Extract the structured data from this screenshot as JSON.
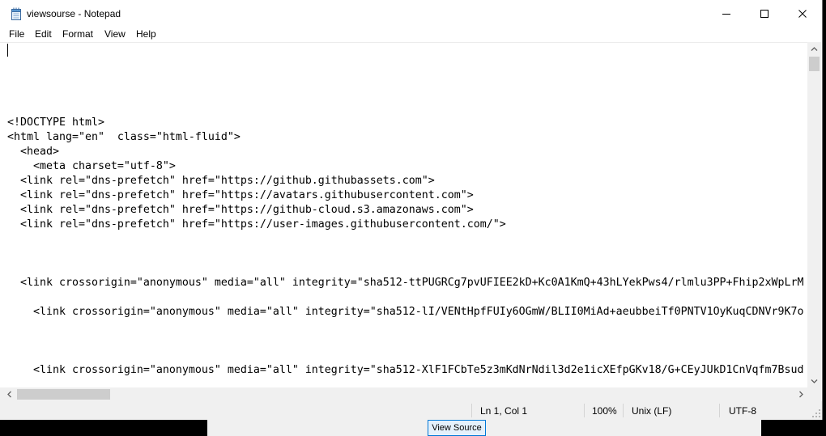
{
  "window": {
    "title": "viewsourse - Notepad",
    "app_icon": "notepad-icon",
    "controls": {
      "minimize": "minimize-icon",
      "maximize": "maximize-icon",
      "close": "close-icon"
    }
  },
  "menu": [
    {
      "label": "File"
    },
    {
      "label": "Edit"
    },
    {
      "label": "Format"
    },
    {
      "label": "View"
    },
    {
      "label": "Help"
    }
  ],
  "editor": {
    "lines": [
      "",
      "",
      "",
      "",
      "",
      "<!DOCTYPE html>",
      "<html lang=\"en\"  class=\"html-fluid\">",
      "  <head>",
      "    <meta charset=\"utf-8\">",
      "  <link rel=\"dns-prefetch\" href=\"https://github.githubassets.com\">",
      "  <link rel=\"dns-prefetch\" href=\"https://avatars.githubusercontent.com\">",
      "  <link rel=\"dns-prefetch\" href=\"https://github-cloud.s3.amazonaws.com\">",
      "  <link rel=\"dns-prefetch\" href=\"https://user-images.githubusercontent.com/\">",
      "",
      "",
      "",
      "  <link crossorigin=\"anonymous\" media=\"all\" integrity=\"sha512-ttPUGRCg7pvUFIEE2kD+Kc0A1KmQ+43hLYekPws4/rlmlu3PP+Fhip2xWpLrM",
      "",
      "    <link crossorigin=\"anonymous\" media=\"all\" integrity=\"sha512-lI/VENtHpfFUIy6OGmW/BLII0MiAd+aeubbeiTf0PNTV1OyKuqCDNVr9K7o",
      "",
      "",
      "",
      "    <link crossorigin=\"anonymous\" media=\"all\" integrity=\"sha512-XlF1FCbTe5z3mKdNrNdil3d2e1icXEfpGKv18/G+CEyJUkD1CnVqfm7Bsud"
    ]
  },
  "scrollbars": {
    "vertical": {
      "position_percent": 0,
      "up_icon": "chevron-up-icon",
      "down_icon": "chevron-down-icon"
    },
    "horizontal": {
      "position_percent": 0,
      "left_icon": "chevron-left-icon",
      "right_icon": "chevron-right-icon"
    }
  },
  "status": {
    "cursor": "Ln 1, Col 1",
    "zoom": "100%",
    "line_ending": "Unix (LF)",
    "encoding": "UTF-8",
    "grip_icon": "size-grip-icon"
  },
  "background_window": {
    "button_label": "View Source"
  },
  "colors": {
    "window_bg": "#ffffff",
    "chrome_bg": "#f0f0f0",
    "text": "#000000",
    "scroll_thumb": "#cdcdcd",
    "scroll_arrow": "#606060",
    "separator": "#d4d4d4",
    "focus_border": "#0078d7",
    "button_bg": "#e5f1fb",
    "desktop": "#000000"
  }
}
